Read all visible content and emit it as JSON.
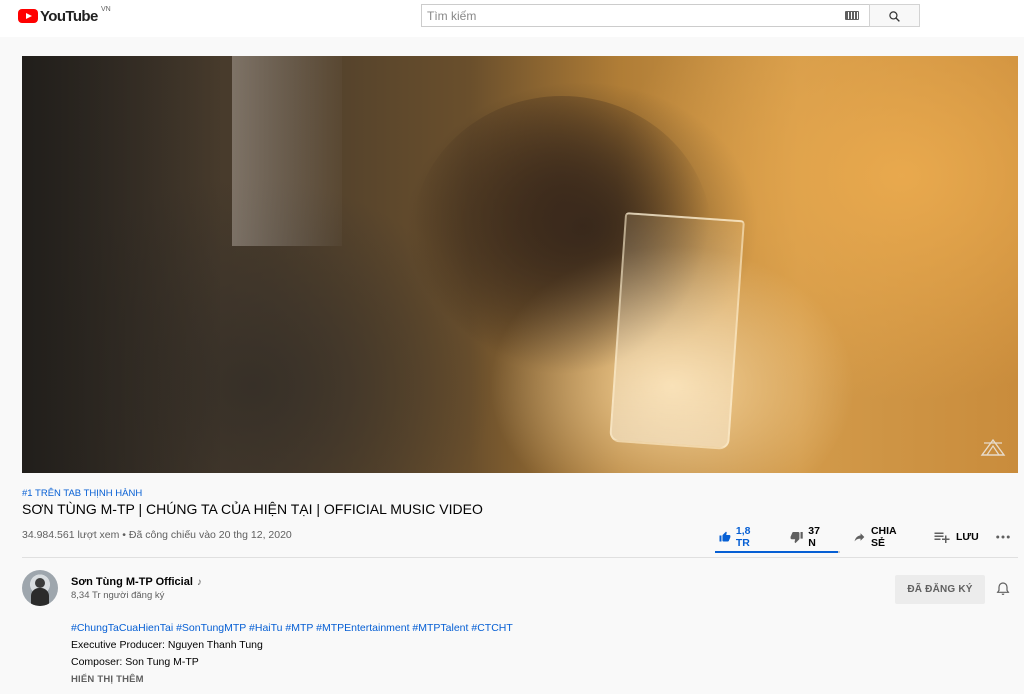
{
  "masthead": {
    "logo_text": "YouTube",
    "country_code": "VN",
    "search_placeholder": "Tìm kiếm"
  },
  "video": {
    "trending_badge": "#1 TRÊN TAB THỊNH HÀNH",
    "title": "SƠN TÙNG M-TP | CHÚNG TA CỦA HIỆN TẠI | OFFICIAL MUSIC VIDEO",
    "view_info": "34.984.561 lượt xem • Đã công chiếu vào 20 thg 12, 2020",
    "like_count": "1,8 TR",
    "dislike_count": "37 N",
    "share_label": "CHIA SẺ",
    "save_label": "LƯU",
    "like_ratio": 0.98
  },
  "channel": {
    "name": "Sơn Tùng M-TP Official",
    "subscribers": "8,34 Tr người đăng ký",
    "subscribed_label": "ĐÃ ĐĂNG KÝ"
  },
  "description": {
    "hashtags": "#ChungTaCuaHienTai #SonTungMTP #HaiTu #MTP #MTPEntertainment #MTPTalent #CTCHT",
    "line_producer": "Executive Producer: Nguyen Thanh Tung",
    "line_composer": "Composer: Son Tung M-TP",
    "show_more": "HIỂN THỊ THÊM"
  },
  "icons": {
    "like": "thumbs-up-icon",
    "dislike": "thumbs-down-icon",
    "share": "share-arrow-icon",
    "save": "playlist-add-icon",
    "more": "more-horizontal-icon",
    "bell": "bell-icon",
    "search": "search-icon",
    "keyboard": "keyboard-icon"
  },
  "colors": {
    "brand_red": "#ff0000",
    "link_blue": "#065fd4",
    "secondary_text": "#606060"
  }
}
